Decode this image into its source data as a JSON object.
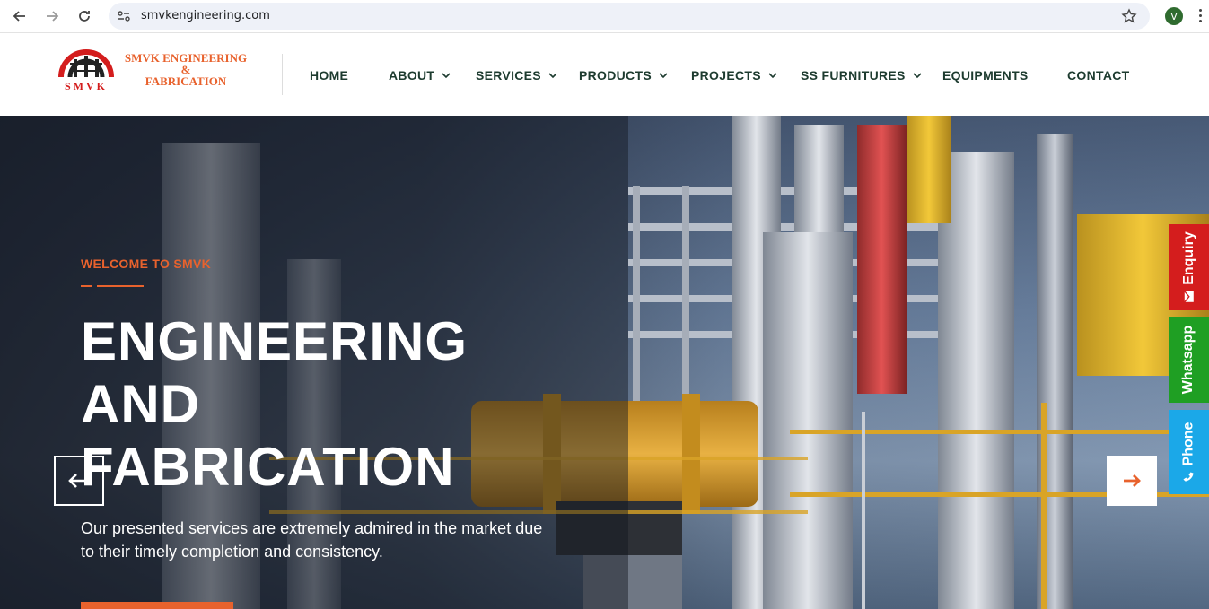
{
  "browser": {
    "url": "smvkengineering.com",
    "profile_initial": "V",
    "icons": [
      "back-icon",
      "forward-icon",
      "reload-icon",
      "site-info-icon",
      "bookmark-star-icon",
      "more-icon"
    ]
  },
  "header": {
    "logo": {
      "emblem_text": "SMVK",
      "line1": "SMVK ENGINEERING",
      "line2": "&",
      "line3": "FABRICATION"
    },
    "nav": [
      {
        "label": "HOME",
        "has_dropdown": false
      },
      {
        "label": "ABOUT",
        "has_dropdown": true
      },
      {
        "label": "SERVICES",
        "has_dropdown": true
      },
      {
        "label": "PRODUCTS",
        "has_dropdown": true
      },
      {
        "label": "PROJECTS",
        "has_dropdown": true
      },
      {
        "label": "SS FURNITURES",
        "has_dropdown": true
      },
      {
        "label": "EQUIPMENTS",
        "has_dropdown": false
      },
      {
        "label": "CONTACT",
        "has_dropdown": false
      }
    ]
  },
  "hero": {
    "kicker": "WELCOME TO SMVK",
    "title_lines": [
      "ENGINEERING",
      "AND",
      "FABRICATION"
    ],
    "description": "Our presented services are extremely admired in the market due to their timely completion and consistency."
  },
  "side_tabs": {
    "enquiry": "Enquiry",
    "whatsapp": "Whatsapp",
    "phone": "Phone"
  },
  "colors": {
    "accent": "#e8622d",
    "nav_text": "#1d3b2f",
    "enquiry": "#d41d1d",
    "whatsapp": "#1f9f23",
    "phone": "#1ba8e8"
  }
}
